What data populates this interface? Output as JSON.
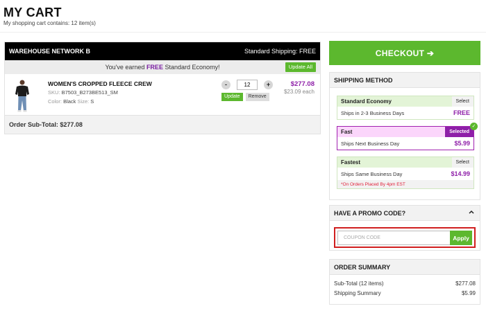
{
  "header": {
    "title": "MY CART",
    "subtitle": "My shopping cart contains: 12 item(s)"
  },
  "cart": {
    "warehouse": "WAREHOUSE NETWORK B",
    "shipping_label": "Standard Shipping: FREE",
    "promo_prefix": "You've earned ",
    "promo_highlight": "FREE",
    "promo_suffix": " Standard Economy!",
    "update_all_label": "Update All",
    "item": {
      "name": "WOMEN'S CROPPED FLEECE CREW",
      "sku_label": "SKU: ",
      "sku": "B7503_B273BE513_SM",
      "color_label": "Color: ",
      "color": "Black",
      "size_label": " Size: ",
      "size": "S",
      "minus": "-",
      "plus": "+",
      "quantity": "12",
      "update_label": "Update",
      "remove_label": "Remove",
      "total": "$277.08",
      "each": "$23.09 each"
    },
    "subtotal": "Order Sub-Total: $277.08"
  },
  "checkout": {
    "label": "CHECKOUT ➔"
  },
  "shipping": {
    "title": "SHIPPING METHOD",
    "options": [
      {
        "name": "Standard Economy",
        "tag": "Select",
        "desc": "Ships in 2-3 Business Days",
        "price": "FREE"
      },
      {
        "name": "Fast",
        "tag": "Selected",
        "desc": "Ships Next Business Day",
        "price": "$5.99"
      },
      {
        "name": "Fastest",
        "tag": "Select",
        "desc": "Ships Same Business Day",
        "price": "$14.99",
        "note": "*On Orders Placed By 4pm EST"
      }
    ]
  },
  "promo": {
    "title": "HAVE A PROMO CODE?",
    "placeholder": "COUPON CODE",
    "apply_label": "Apply"
  },
  "summary": {
    "title": "ORDER SUMMARY",
    "rows": [
      {
        "label": "Sub-Total (12 items)",
        "value": "$277.08"
      },
      {
        "label": "Shipping Summary",
        "value": "$5.99"
      }
    ]
  },
  "colors": {
    "accent_green": "#5cb82e",
    "price_purple": "#8e1fa8",
    "selected_border": "#a020b0",
    "highlight_red": "#d01e1e"
  }
}
